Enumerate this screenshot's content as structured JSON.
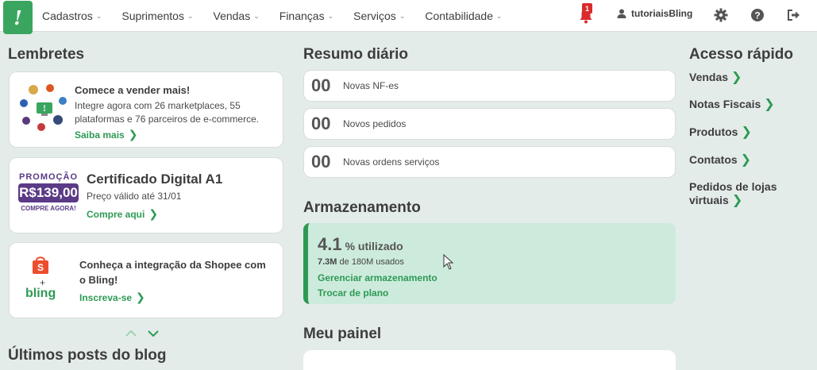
{
  "nav": {
    "menu": [
      {
        "label": "Cadastros"
      },
      {
        "label": "Suprimentos"
      },
      {
        "label": "Vendas"
      },
      {
        "label": "Finanças"
      },
      {
        "label": "Serviços"
      },
      {
        "label": "Contabilidade"
      }
    ],
    "notification_count": "1",
    "username": "tutoriaisBling"
  },
  "lembretes": {
    "title": "Lembretes",
    "card1": {
      "title": "Comece a vender mais!",
      "text": "Integre agora com 26 marketplaces, 55 plataformas e 76 parceiros de e-commerce.",
      "link": "Saiba mais"
    },
    "card2": {
      "promo_label": "PROMOÇÃO",
      "promo_price": "R$139,00",
      "promo_cta": "COMPRE AGORA!",
      "title": "Certificado Digital A1",
      "text": "Preço válido até 31/01",
      "link": "Compre aqui"
    },
    "card3": {
      "title": "Conheça a integração da Shopee com o Bling!",
      "link": "Inscreva-se",
      "plus": "+",
      "brand": "bling"
    }
  },
  "blog": {
    "title": "Últimos posts do blog"
  },
  "resumo": {
    "title": "Resumo diário",
    "items": [
      {
        "value": "00",
        "label": "Novas NF-es"
      },
      {
        "value": "00",
        "label": "Novos pedidos"
      },
      {
        "value": "00",
        "label": "Novas ordens serviços"
      }
    ]
  },
  "armazenamento": {
    "title": "Armazenamento",
    "percent": "4.1",
    "percent_label": "% utilizado",
    "used": "7.3M",
    "of_label": "de 180M usados",
    "manage_link": "Gerenciar armazenamento",
    "plan_link": "Trocar de plano"
  },
  "painel": {
    "title": "Meu painel"
  },
  "acesso": {
    "title": "Acesso rápido",
    "links": [
      {
        "label": "Vendas"
      },
      {
        "label": "Notas Fiscais"
      },
      {
        "label": "Produtos"
      },
      {
        "label": "Contatos"
      },
      {
        "label": "Pedidos de lojas virtuais"
      }
    ]
  },
  "colors": {
    "brand": "#3aa55f",
    "link": "#2d9a54",
    "storage_bg": "#cdebdc",
    "badge": "#d92b2b",
    "promo": "#5b3a86"
  }
}
